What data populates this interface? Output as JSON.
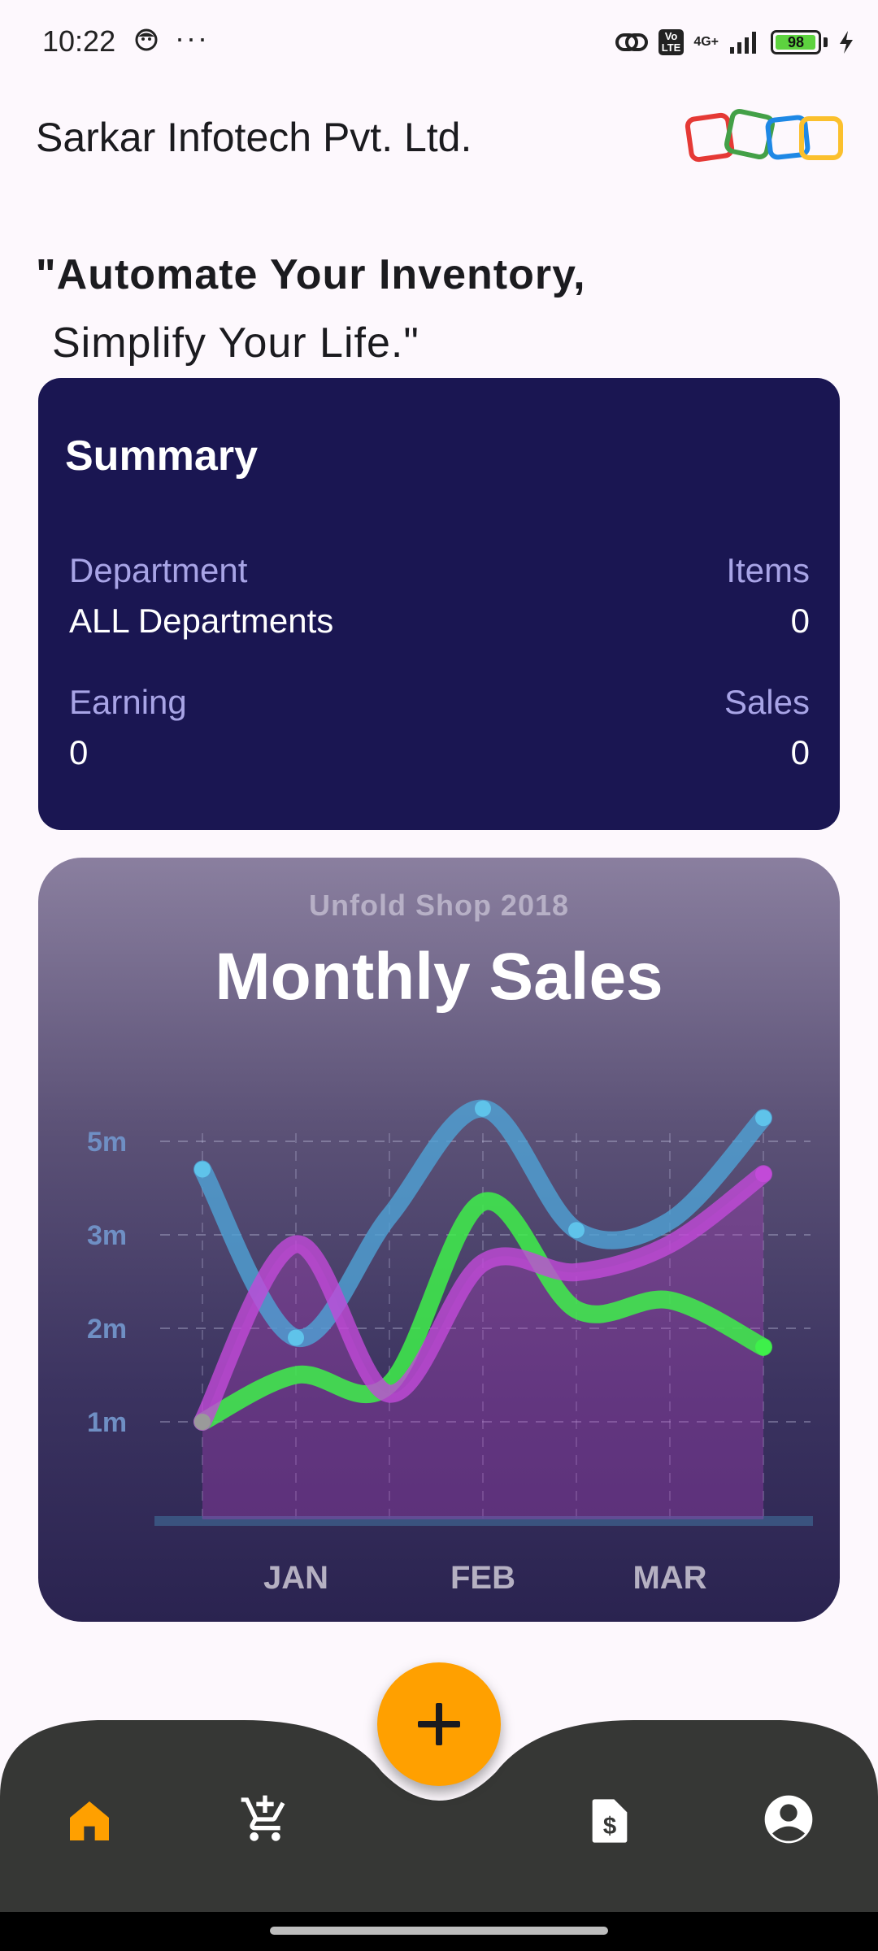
{
  "status_bar": {
    "time": "10:22",
    "dots": "···",
    "volte": "Vo\nLTE",
    "network": "4G+",
    "battery": "98"
  },
  "header": {
    "company_name": "Sarkar Infotech Pvt. Ltd.",
    "logo_colors": [
      "#e53935",
      "#43a047",
      "#1e88e5",
      "#fbc02d"
    ]
  },
  "tagline": {
    "line1": "\"Automate Your Inventory,",
    "line2": "Simplify Your Life.\""
  },
  "summary": {
    "title": "Summary",
    "department_label": "Department",
    "department_value": "ALL Departments",
    "items_label": "Items",
    "items_value": "0",
    "earning_label": "Earning",
    "earning_value": "0",
    "sales_label": "Sales",
    "sales_value": "0"
  },
  "chart": {
    "subtitle": "Unfold Shop 2018",
    "title": "Monthly Sales",
    "chart_data": {
      "type": "line",
      "title": "Monthly Sales",
      "subtitle": "Unfold Shop 2018",
      "categories": [
        "JAN",
        "FEB",
        "MAR"
      ],
      "y_ticks": [
        "1m",
        "2m",
        "3m",
        "5m"
      ],
      "grid": true,
      "series": [
        {
          "color": "#4fa3d6",
          "x": [
            0,
            0.5,
            1,
            1.5,
            2,
            2.5,
            3
          ],
          "y": [
            4.4,
            1.9,
            3.4,
            5.7,
            3.1,
            3.3,
            5.5
          ]
        },
        {
          "color": "#3ef04a",
          "x": [
            0,
            0.5,
            1,
            1.5,
            2,
            2.5,
            3
          ],
          "y": [
            1.0,
            1.5,
            1.4,
            3.7,
            2.2,
            2.3,
            1.8
          ]
        },
        {
          "color": "#c24ad8",
          "x": [
            0,
            0.5,
            1,
            1.5,
            2,
            2.5,
            3
          ],
          "y": [
            1.0,
            2.9,
            1.3,
            2.7,
            2.6,
            2.9,
            4.3
          ]
        }
      ]
    }
  },
  "nav": {
    "fab_label": "+",
    "accent": "#ffa000",
    "items": [
      "home-icon",
      "add-cart-icon",
      "invoice-icon",
      "account-icon"
    ]
  }
}
